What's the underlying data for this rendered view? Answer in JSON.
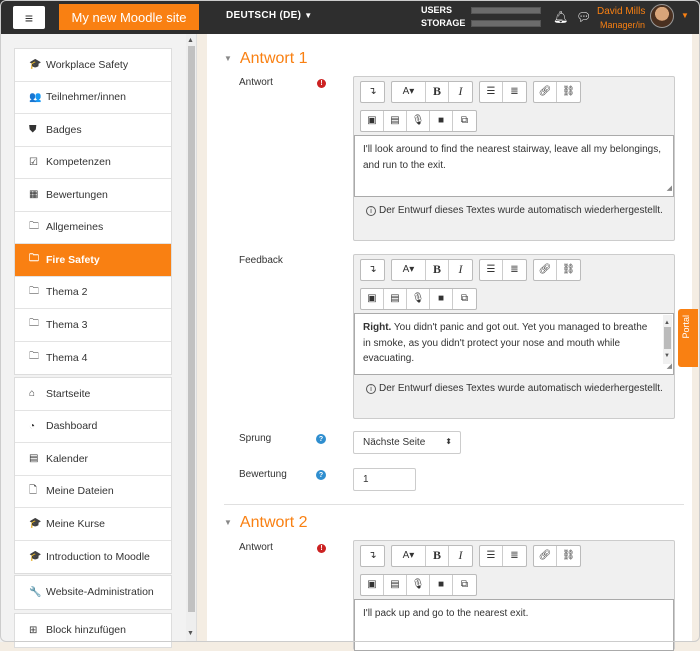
{
  "topbar": {
    "site_name": "My new Moodle site",
    "language": "DEUTSCH (DE)",
    "stats": [
      {
        "label": "USERS",
        "fill": 0.0
      },
      {
        "label": "STORAGE",
        "fill": 0.0
      }
    ],
    "user_name": "David Mills",
    "user_role": "Manager/in"
  },
  "sidebar": {
    "group1": [
      {
        "icon": "graduation-cap-icon",
        "glyph": "🎓",
        "label": "Workplace Safety"
      },
      {
        "icon": "users-icon",
        "glyph": "👥",
        "label": "Teilnehmer/innen"
      },
      {
        "icon": "shield-icon",
        "glyph": "⛊",
        "label": "Badges"
      },
      {
        "icon": "checkbox-icon",
        "glyph": "☑",
        "label": "Kompetenzen"
      },
      {
        "icon": "table-icon",
        "glyph": "▦",
        "label": "Bewertungen"
      },
      {
        "icon": "folder-icon",
        "glyph": "🗀",
        "label": "Allgemeines"
      },
      {
        "icon": "folder-icon",
        "glyph": "🗀",
        "label": "Fire Safety",
        "active": true
      },
      {
        "icon": "folder-icon",
        "glyph": "🗀",
        "label": "Thema 2"
      },
      {
        "icon": "folder-icon",
        "glyph": "🗀",
        "label": "Thema 3"
      },
      {
        "icon": "folder-icon",
        "glyph": "🗀",
        "label": "Thema 4"
      }
    ],
    "group2": [
      {
        "icon": "home-icon",
        "glyph": "⌂",
        "label": "Startseite"
      },
      {
        "icon": "dashboard-icon",
        "glyph": "◔",
        "label": "Dashboard"
      },
      {
        "icon": "calendar-icon",
        "glyph": "▤",
        "label": "Kalender"
      },
      {
        "icon": "file-icon",
        "glyph": "🗋",
        "label": "Meine Dateien"
      },
      {
        "icon": "graduation-cap-icon",
        "glyph": "🎓",
        "label": "Meine Kurse"
      },
      {
        "icon": "graduation-cap-icon",
        "glyph": "🎓",
        "label": "Introduction to Moodle"
      }
    ],
    "group3": [
      {
        "icon": "wrench-icon",
        "glyph": "🔧",
        "label": "Website-Administration"
      }
    ],
    "group4": [
      {
        "icon": "plus-square-icon",
        "glyph": "⊞",
        "label": "Block hinzufügen"
      }
    ]
  },
  "main": {
    "section1": {
      "title": "Antwort 1",
      "answer_label": "Antwort",
      "answer_text": "I'll look around to find the nearest stairway, leave all my belongings, and run to the exit.",
      "autosave_text": "Der Entwurf dieses Textes wurde automatisch wiederhergestellt.",
      "feedback_label": "Feedback",
      "feedback_bold": "Right.",
      "feedback_text": " You didn't panic and got out. Yet you managed to breathe in smoke, as you didn't protect your nose and mouth while evacuating.",
      "feedback_autosave": "Der Entwurf dieses Textes wurde automatisch wiederhergestellt.",
      "jump_label": "Sprung",
      "jump_value": "Nächste Seite",
      "score_label": "Bewertung",
      "score_value": "1"
    },
    "section2": {
      "title": "Antwort 2",
      "answer_label": "Antwort",
      "answer_text": "I'll pack up and go to the nearest exit."
    }
  },
  "portal": {
    "label": "Portal"
  },
  "colors": {
    "accent": "#f98012",
    "topbar": "#2e2e2e",
    "required": "#cc2222",
    "help": "#2f8ecf"
  }
}
